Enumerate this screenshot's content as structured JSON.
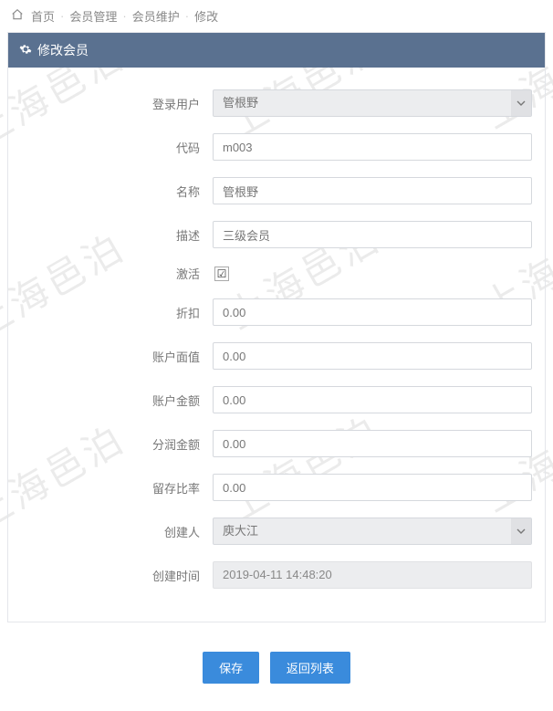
{
  "watermark_text": "上海邑泊",
  "breadcrumb": {
    "home": "首页",
    "l1": "会员管理",
    "l2": "会员维护",
    "l3": "修改"
  },
  "panel": {
    "title": "修改会员"
  },
  "form": {
    "login_user": {
      "label": "登录用户",
      "value": "管根野"
    },
    "code": {
      "label": "代码",
      "value": "m003"
    },
    "name": {
      "label": "名称",
      "value": "管根野"
    },
    "desc": {
      "label": "描述",
      "value": "三级会员"
    },
    "active": {
      "label": "激活",
      "checked": true,
      "glyph": "☑"
    },
    "discount": {
      "label": "折扣",
      "value": "0.00"
    },
    "face_value": {
      "label": "账户面值",
      "value": "0.00"
    },
    "balance": {
      "label": "账户金额",
      "value": "0.00"
    },
    "dividend": {
      "label": "分润金额",
      "value": "0.00"
    },
    "retain_rate": {
      "label": "留存比率",
      "value": "0.00"
    },
    "creator": {
      "label": "创建人",
      "value": "庾大江"
    },
    "created_at": {
      "label": "创建时间",
      "value": "2019-04-11 14:48:20"
    }
  },
  "buttons": {
    "save": "保存",
    "back": "返回列表"
  }
}
